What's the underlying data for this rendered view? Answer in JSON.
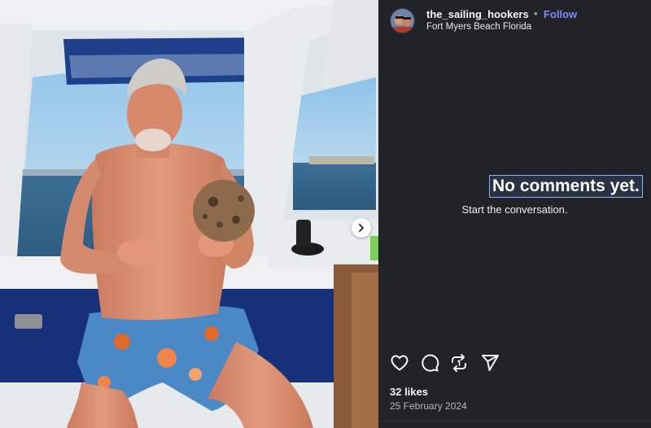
{
  "post": {
    "username": "the_sailing_hookers",
    "separator": "•",
    "follow_label": "Follow",
    "location": "Fort Myers Beach Florida"
  },
  "comments": {
    "empty_title": "No comments yet.",
    "empty_subtitle": "Start the conversation."
  },
  "actions": {
    "icons": [
      "heart-icon",
      "comment-icon",
      "repost-icon",
      "share-icon"
    ]
  },
  "stats": {
    "likes": "32 likes",
    "date": "25 February 2024"
  },
  "media": {
    "next_icon": "chevron-right-icon"
  },
  "colors": {
    "panel_bg": "#212328",
    "follow_accent": "#7b8cff",
    "text_primary": "#f5f5f5",
    "text_secondary": "#b5b5b5"
  }
}
